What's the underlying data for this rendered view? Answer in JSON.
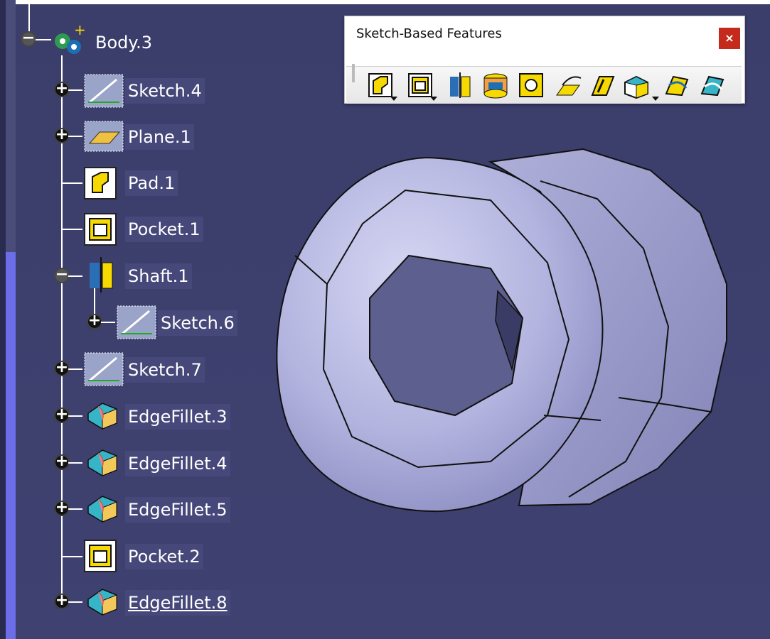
{
  "toolbar": {
    "title": "Sketch-Based Features",
    "close": "×",
    "buttons": [
      {
        "name": "pad-icon",
        "has_dropdown": true
      },
      {
        "name": "pocket-icon",
        "has_dropdown": true
      },
      {
        "name": "shaft-icon",
        "has_dropdown": false
      },
      {
        "name": "groove-icon",
        "has_dropdown": false
      },
      {
        "name": "hole-icon",
        "has_dropdown": false
      },
      {
        "name": "rib-icon",
        "has_dropdown": false
      },
      {
        "name": "slot-icon",
        "has_dropdown": false
      },
      {
        "name": "stiffener-icon",
        "has_dropdown": true
      },
      {
        "name": "multi-section-solid-icon",
        "has_dropdown": false
      },
      {
        "name": "removed-multi-section-solid-icon",
        "has_dropdown": false
      }
    ]
  },
  "tree": {
    "body": {
      "label": "Body.3"
    },
    "items": [
      {
        "label": "Sketch.4"
      },
      {
        "label": "Plane.1"
      },
      {
        "label": "Pad.1"
      },
      {
        "label": "Pocket.1"
      },
      {
        "label": "Shaft.1"
      },
      {
        "label": "Sketch.6"
      },
      {
        "label": "Sketch.7"
      },
      {
        "label": "EdgeFillet.3"
      },
      {
        "label": "EdgeFillet.4"
      },
      {
        "label": "EdgeFillet.5"
      },
      {
        "label": "Pocket.2"
      },
      {
        "label": "EdgeFillet.8"
      }
    ]
  },
  "colors": {
    "background": "#3c3e6a",
    "part_surface": "#b7b8e0",
    "label_bg": "#46487a",
    "close_red": "#c42b1c"
  }
}
